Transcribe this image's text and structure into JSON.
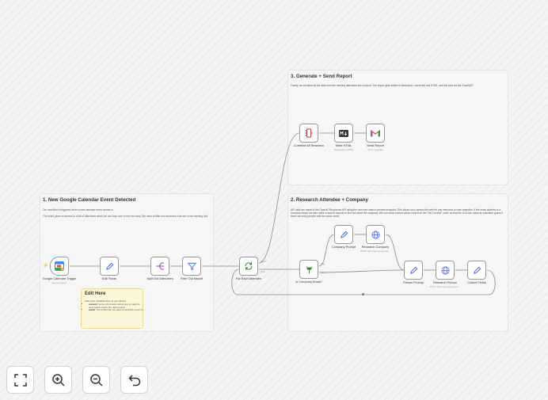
{
  "sections": {
    "s1": {
      "title": "1. New Google Calendar Event Detected",
      "desc1": "Our workflow is triggered when a new calendar event comes in.",
      "desc2": "The event gives us access to a list of attendees which we can loop over in the next step. We need to filter out ourselves if we are in the meeting too!"
    },
    "s2": {
      "title": "2. Research Attendee + Company",
      "desc": "API calls are made to the OpenAI Responses API using the new web search preview endpoint. This allows us to search the web for any mentions of each attendee. If the email address is a company email, we also make a search request to find out about the company. We use some context about ourself on the \"Set Context\" node, so that the LLM can make an educated guess if there are many people with the same name."
    },
    "s3": {
      "title": "3. Generate + Send Report",
      "desc": "Finally, we combine all the data from the meeting attendees into a report. The report gets written in Markdown, converted into HTML, and the sent via the Gmail API."
    }
  },
  "nodes": {
    "trigger": {
      "label": "Google Calendar Trigger",
      "sub": "Event Created"
    },
    "edit_fields": {
      "label": "Edit Fields"
    },
    "split": {
      "label": "Split Out Attendees"
    },
    "filter": {
      "label": "Filter Out Myself"
    },
    "loop": {
      "label": "For Each Attendee",
      "out_done": "done",
      "out_loop": "loop"
    },
    "if_company": {
      "label": "Is Company Email?",
      "out_true": "true",
      "out_false": "false"
    },
    "company_prompt": {
      "label": "Company Prompt"
    },
    "research_company": {
      "label": "Research Company",
      "sub": "POST: https://api.openai.com..."
    },
    "person_prompt": {
      "label": "Person Prompt"
    },
    "research_person": {
      "label": "Research Person",
      "sub": "POST: https://api.openai.com..."
    },
    "collect": {
      "label": "Collect Fields"
    },
    "combine": {
      "label": "Combine All Research"
    },
    "write_html": {
      "label": "Write HTML",
      "sub": "Markdown to HTML"
    },
    "send_report": {
      "label": "Send Report",
      "sub": "send: message"
    }
  },
  "note": {
    "title": "Edit Here",
    "intro": "Add a few variables here to get started:",
    "items": [
      {
        "key": "context",
        "text": ": Some information about you to help the web search return the right people"
      },
      {
        "key": "email",
        "text": ": The email that you want to send the report to"
      }
    ]
  },
  "controls": [
    {
      "name": "fit-view",
      "icon": "fit-view-icon"
    },
    {
      "name": "zoom-in",
      "icon": "zoom-in-icon"
    },
    {
      "name": "zoom-out",
      "icon": "zoom-out-icon"
    },
    {
      "name": "undo",
      "icon": "undo-icon"
    }
  ],
  "colors": {
    "accent_red": "#e53935",
    "note_bg": "#fdf6d8",
    "edge": "#8a8a8a"
  }
}
